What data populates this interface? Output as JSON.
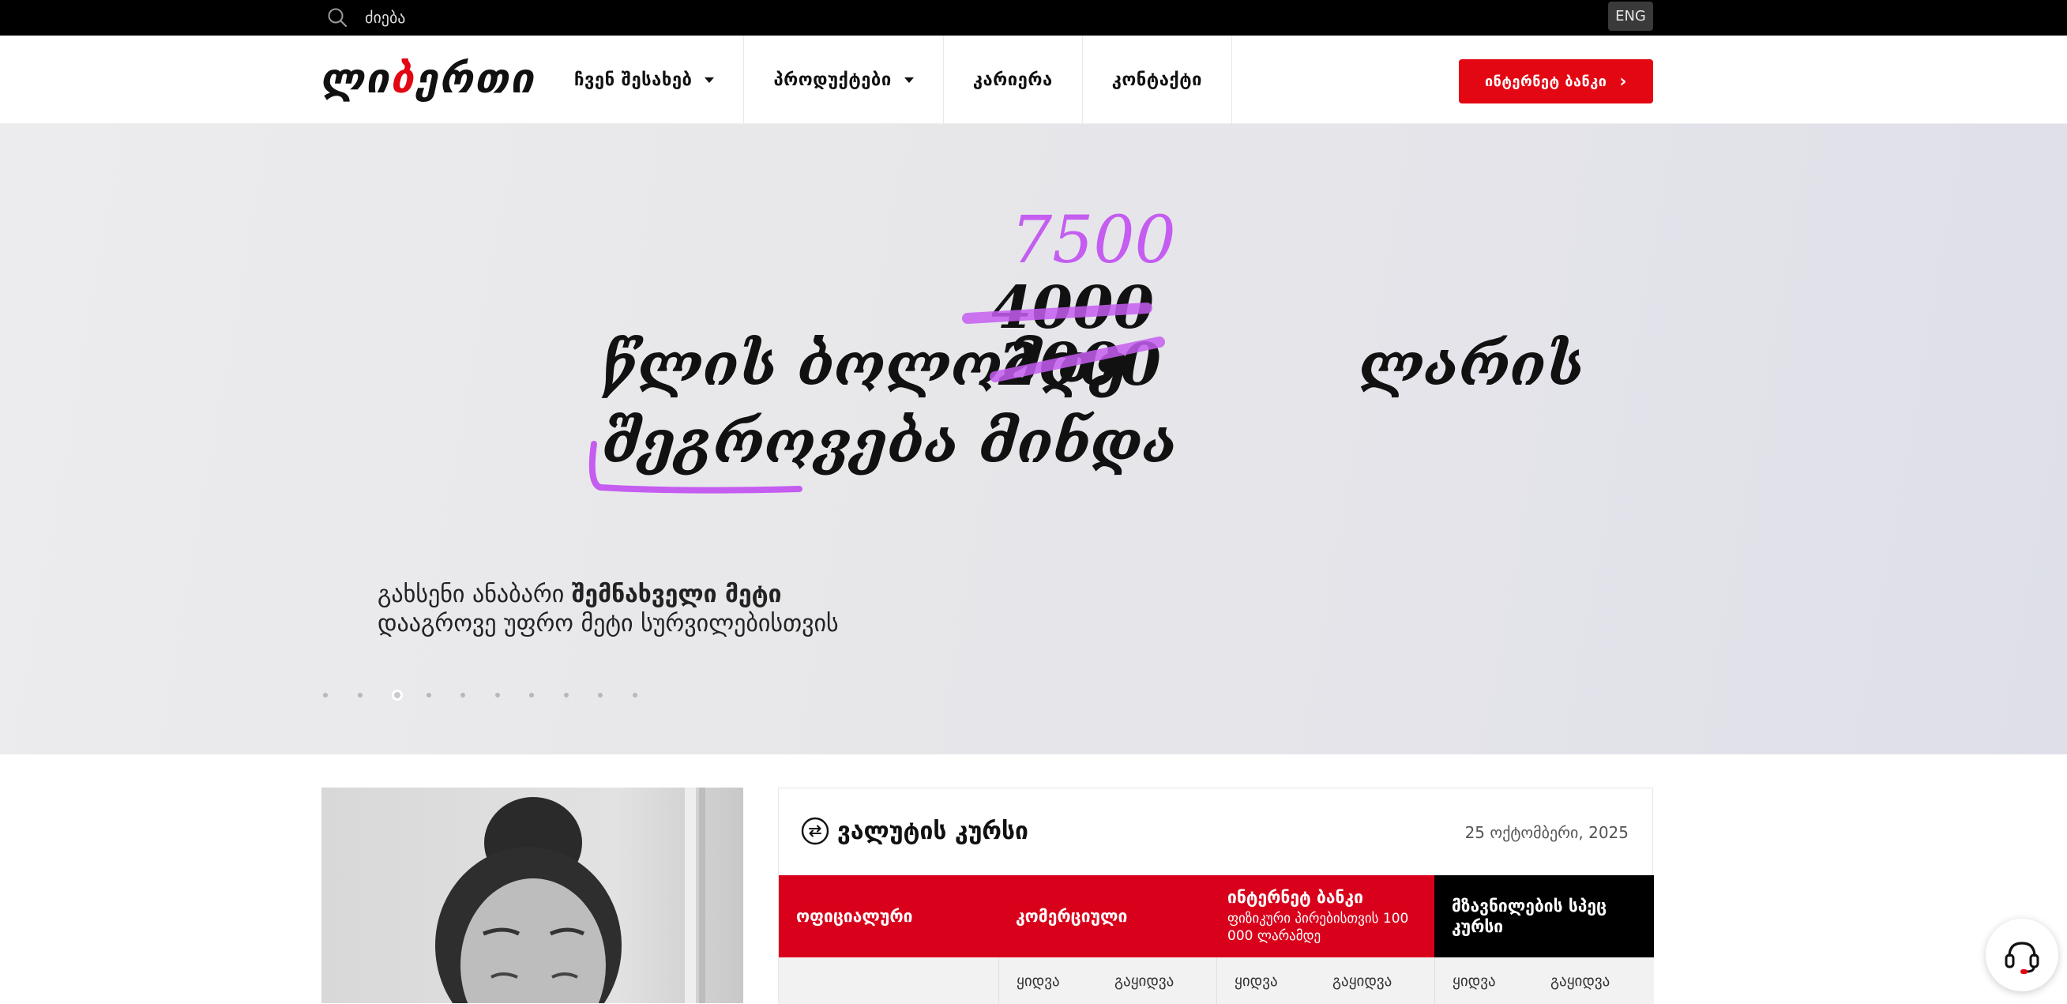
{
  "topbar": {
    "search_placeholder": "ძიება",
    "lang_label": "ENG"
  },
  "header": {
    "logo_main": "ლი",
    "logo_accent": "ბ",
    "logo_end": "ერთი",
    "nav": [
      {
        "label": "ჩვენ შესახებ",
        "has_dropdown": true
      },
      {
        "label": "პროდუქტები",
        "has_dropdown": true
      },
      {
        "label": "კარიერა",
        "has_dropdown": false
      },
      {
        "label": "კონტაქტი",
        "has_dropdown": false
      }
    ],
    "ibank_label": "ინტერნეტ ბანკი"
  },
  "hero": {
    "line1_start": "წლის ბოლომდე",
    "struck_1": "4000",
    "struck_2": "2000",
    "line1_end": "ლარის",
    "new_amount": "7500",
    "line2": "შეგროვება მინდა",
    "sub1_regular": "გახსენი ანაბარი ",
    "sub1_bold": "შემნახველი მეტი",
    "sub2": "დააგროვე უფრო მეტი სურვილებისთვის",
    "slide_count": 10,
    "active_slide": 3,
    "accent_color": "#c45df0"
  },
  "rates": {
    "title": "ვალუტის კურსი",
    "date": "25 ოქტომბერი, 2025",
    "columns": [
      {
        "title": "ოფიციალური",
        "subtitle": "",
        "color": "#d9001b"
      },
      {
        "title": "კომერციული",
        "subtitle": "",
        "color": "#d9001b"
      },
      {
        "title": "ინტერნეტ ბანკი",
        "subtitle": "ფიზიკური პირებისთვის 100 000 ლარამდე",
        "color": "#d9001b"
      },
      {
        "title": "მზავნილების სპეც კურსი",
        "subtitle": "",
        "color": "#000000"
      }
    ],
    "buy_label": "ყიდვა",
    "sell_label": "გაყიდვა"
  },
  "colors": {
    "brand_red": "#e30613",
    "topbar_bg": "#000000"
  }
}
